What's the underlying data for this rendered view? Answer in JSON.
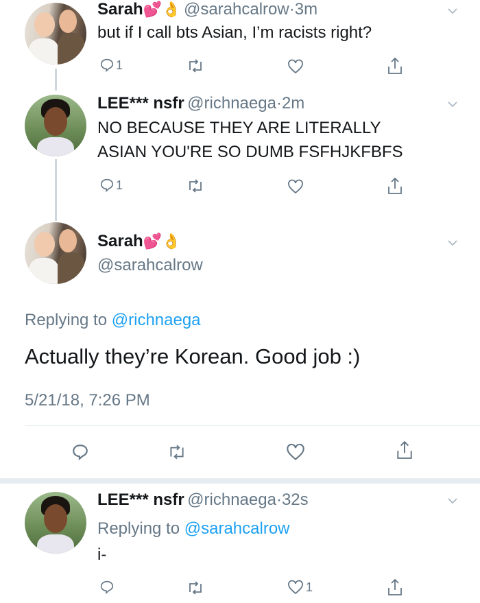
{
  "tweets": [
    {
      "name": "Sarah",
      "handle": "@sarahcalrow",
      "sep": "·",
      "time": "3m",
      "text": "but if I call bts Asian, I’m racists right?",
      "reply_count": "1"
    },
    {
      "name": "LEE*** nsfr",
      "handle": "@richnaega",
      "sep": "·",
      "time": "2m",
      "text_line1": "NO BECAUSE THEY ARE LITERALLY",
      "text_line2": "ASIAN YOU'RE SO DUMB FSFHJKFBFS",
      "reply_count": "1"
    }
  ],
  "focused": {
    "name": "Sarah",
    "handle": "@sarahcalrow",
    "replying_prefix": "Replying to",
    "replying_handle": "@richnaega",
    "text": "Actually they’re Korean. Good job :)",
    "timestamp": "5/21/18, 7:26 PM"
  },
  "reply": {
    "name": "LEE*** nsfr",
    "handle": "@richnaega",
    "sep": "·",
    "time": "32s",
    "replying_prefix": "Replying to",
    "replying_handle": "@sarahcalrow",
    "text": "i-",
    "like_count": "1"
  },
  "colors": {
    "accent": "#1da1f2",
    "secondary": "#657786",
    "divider": "#e6ecf0"
  }
}
